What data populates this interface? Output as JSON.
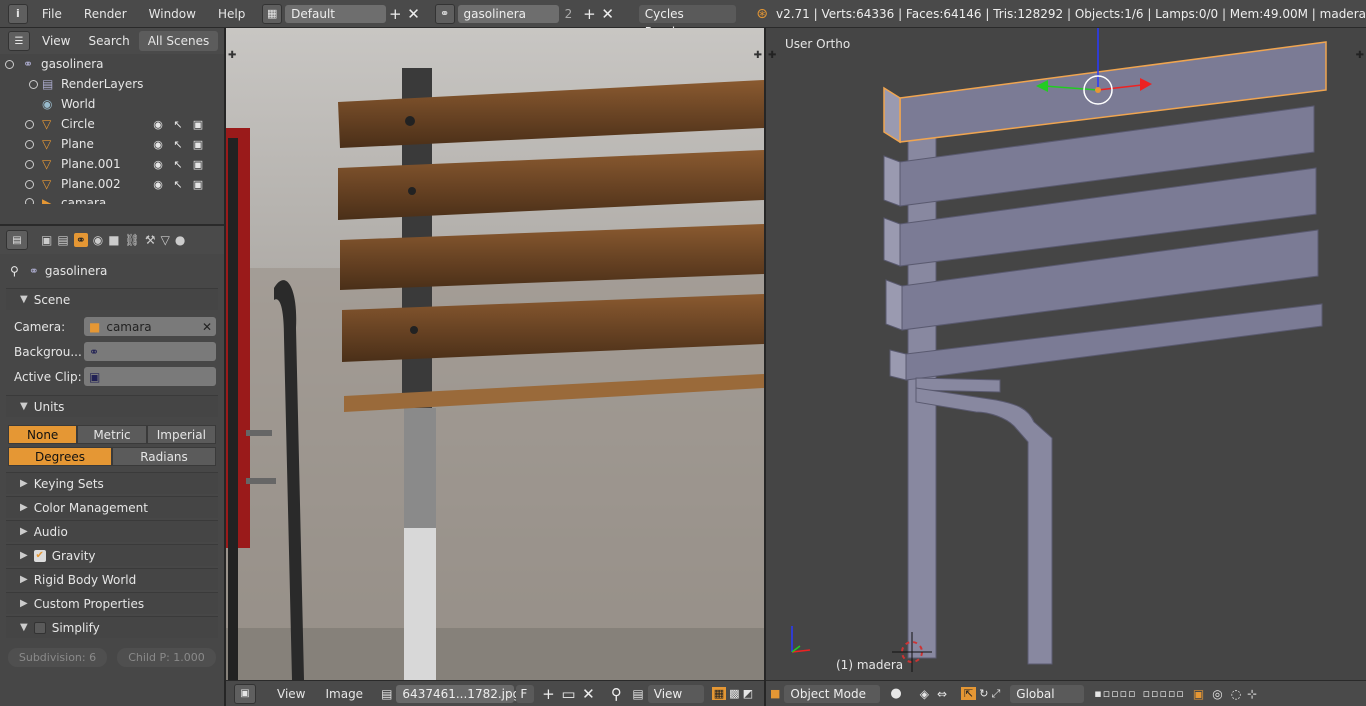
{
  "topbar": {
    "menus": [
      "File",
      "Render",
      "Window",
      "Help"
    ],
    "layout": "Default",
    "scene": "gasolinera",
    "scene_count": "2",
    "engine": "Cycles Render",
    "stats": "v2.71 | Verts:64336 | Faces:64146 | Tris:128292 | Objects:1/6 | Lamps:0/0 | Mem:49.00M | madera"
  },
  "outliner": {
    "tabs": [
      "View",
      "Search",
      "All Scenes"
    ],
    "rows": [
      {
        "label": "gasolinera"
      },
      {
        "label": "RenderLayers"
      },
      {
        "label": "World"
      },
      {
        "label": "Circle"
      },
      {
        "label": "Plane"
      },
      {
        "label": "Plane.001"
      },
      {
        "label": "Plane.002"
      },
      {
        "label": "camara"
      }
    ]
  },
  "properties": {
    "breadcrumb": "gasolinera",
    "scene_section": "Scene",
    "camera_label": "Camera:",
    "camera_value": "camara",
    "background_label": "Backgrou...",
    "active_clip_label": "Active Clip:",
    "units_section": "Units",
    "unit_systems": [
      "None",
      "Metric",
      "Imperial"
    ],
    "rotation_units": [
      "Degrees",
      "Radians"
    ],
    "sections": [
      "Keying Sets",
      "Color Management",
      "Audio",
      "Gravity",
      "Rigid Body World",
      "Custom Properties",
      "Simplify"
    ],
    "subdivision": "Subdivision: 6",
    "child_p": "Child P: 1.000"
  },
  "image_editor": {
    "menus": [
      "View",
      "Image"
    ],
    "image_name": "6437461...1782.jpg",
    "fake_user": "F",
    "view_label": "View"
  },
  "viewport": {
    "header": "User Ortho",
    "object_label": "(1) madera",
    "mode": "Object Mode",
    "orientation": "Global"
  },
  "colors": {
    "accent": "#e59734",
    "selection_outline": "#f0a550",
    "mesh": "#7b7b95"
  }
}
